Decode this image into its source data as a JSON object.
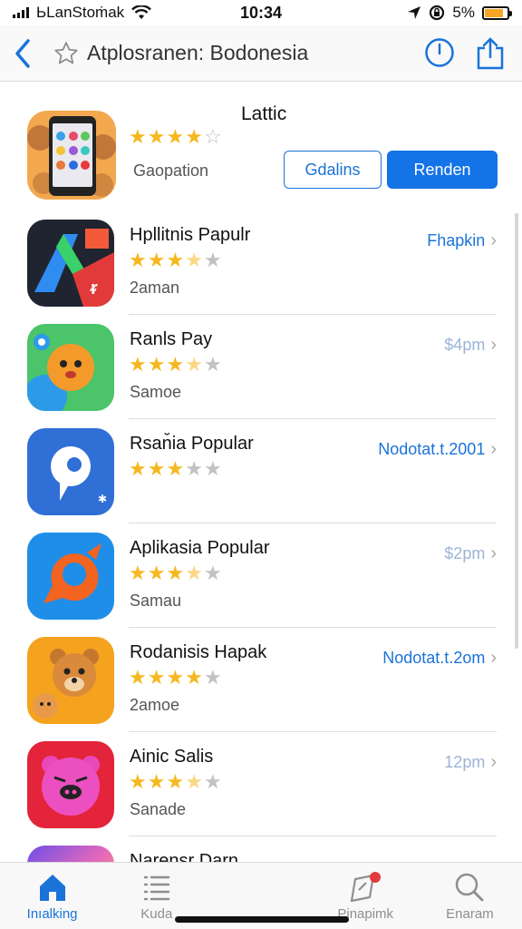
{
  "status": {
    "carrier": "ЬLanStoṁak",
    "time": "10:34",
    "battery": "5%",
    "battery_level": 0.85,
    "battery_color": "#f5a623"
  },
  "nav": {
    "title": "Atplosranen: Bodonesia",
    "back_icon": "chevron-left-icon",
    "star_icon": "star-outline-icon",
    "clock_icon": "clock-icon",
    "share_icon": "share-icon"
  },
  "featured": {
    "title": "Lattic",
    "subtitle": "Gaopation",
    "rating": 4,
    "button_secondary": "Gdalins",
    "button_primary": "Renden"
  },
  "apps": [
    {
      "name": "Hpllitnis Papulr",
      "subtitle": "2aman",
      "rating": 3.5,
      "action": "Fhapkin",
      "action_color": "#1a73d9",
      "icon": "app-a-icon"
    },
    {
      "name": "Ranls Pay",
      "subtitle": "Samoe",
      "rating": 3.5,
      "action": "$4pm",
      "action_color": "#9db4d6",
      "icon": "fox-icon"
    },
    {
      "name": "Rsan̆ia Popular",
      "subtitle": "",
      "rating": 3,
      "action": "Nodotat.t.2001",
      "action_color": "#1a73d9",
      "icon": "pin-icon"
    },
    {
      "name": "Aplikasia Popular",
      "subtitle": "Samau",
      "rating": 3.5,
      "action": "$2pm",
      "action_color": "#9db4d6",
      "icon": "fish-icon"
    },
    {
      "name": "Rodanisis Hapak",
      "subtitle": "2amoe",
      "rating": 4,
      "action": "Nodotat.t.2om",
      "action_color": "#1a73d9",
      "icon": "bear-icon"
    },
    {
      "name": "Ainic Salis",
      "subtitle": "Sanade",
      "rating": 3.5,
      "action": "12pm",
      "action_color": "#9db4d6",
      "icon": "pig-icon"
    },
    {
      "name": "Narensr Darn",
      "subtitle": "",
      "rating": 0,
      "action": "",
      "action_color": "#9db4d6",
      "icon": "gradient-icon"
    }
  ],
  "tabs": [
    {
      "label": "Inıalking",
      "icon": "home-icon",
      "active": true
    },
    {
      "label": "Kuda",
      "icon": "list-icon",
      "active": false
    },
    {
      "label": "",
      "icon": "blank-icon",
      "active": false
    },
    {
      "label": "Pinapimk",
      "icon": "bookmark-icon",
      "active": false
    },
    {
      "label": "Enaram",
      "icon": "search-icon",
      "active": false
    }
  ],
  "colors": {
    "accent": "#1a73d9",
    "star": "#f6b820",
    "star_empty": "#c2c2c2"
  }
}
